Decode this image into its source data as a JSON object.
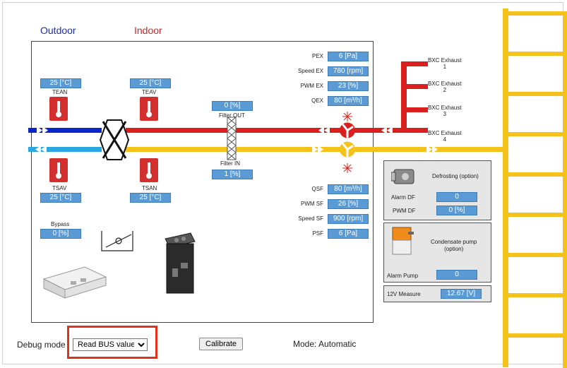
{
  "labels": {
    "outdoor": "Outdoor",
    "indoor": "Indoor"
  },
  "colors": {
    "outdoor": "#1a2fb0",
    "indoor": "#c62828",
    "exhaust": "#d9201e",
    "supply": "#f5c21b",
    "intake": "#0b26c8",
    "extract": "#2aa7e0",
    "value": "#5b9bd5",
    "highlight": "#e0321c"
  },
  "sensors": {
    "tean": {
      "value": "25 [°C]",
      "label": "TEAN"
    },
    "teav": {
      "value": "25 [°C]",
      "label": "TEAV"
    },
    "tsav": {
      "value": "25 [°C]",
      "label": "TSAV"
    },
    "tsan": {
      "value": "25 [°C]",
      "label": "TSAN"
    }
  },
  "filter_out": {
    "value": "0 [%]",
    "label": "Filter OUT"
  },
  "filter_in": {
    "value": "1 [%]",
    "label": "Filter IN"
  },
  "exhaust": [
    {
      "label": "PEX",
      "value": "6 [Pa]"
    },
    {
      "label": "Speed EX",
      "value": "780 [rpm]"
    },
    {
      "label": "PWM EX",
      "value": "23 [%]"
    },
    {
      "label": "QEX",
      "value": "80 [m³/h]"
    }
  ],
  "supply": [
    {
      "label": "QSF",
      "value": "80 [m³/h]"
    },
    {
      "label": "PWM SF",
      "value": "26 [%]"
    },
    {
      "label": "Speed SF",
      "value": "900 [rpm]"
    },
    {
      "label": "PSF",
      "value": "6 [Pa]"
    }
  ],
  "bxc": [
    {
      "line1": "BXC Exhaust",
      "line2": "1"
    },
    {
      "line1": "BXC Exhaust",
      "line2": "2"
    },
    {
      "line1": "BXC Exhaust",
      "line2": "3"
    },
    {
      "line1": "BXC Exhaust",
      "line2": "4"
    }
  ],
  "bypass": {
    "label": "Bypass",
    "value": "0 [%]"
  },
  "defrost": {
    "title": "Defrosting (option)",
    "alarm_label": "Alarm DF",
    "alarm_value": "0",
    "pwm_label": "PWM DF",
    "pwm_value": "0 [%]"
  },
  "condensate": {
    "title_line1": "Condensate pump",
    "title_line2": "(option)",
    "alarm_label": "Alarm Pump",
    "alarm_value": "0"
  },
  "measure": {
    "label": "12V Measure",
    "value": "12.67 [V]"
  },
  "footer": {
    "debug_label": "Debug mode",
    "debug_selected": "Read BUS values",
    "calibrate": "Calibrate",
    "mode": "Mode: Automatic"
  }
}
